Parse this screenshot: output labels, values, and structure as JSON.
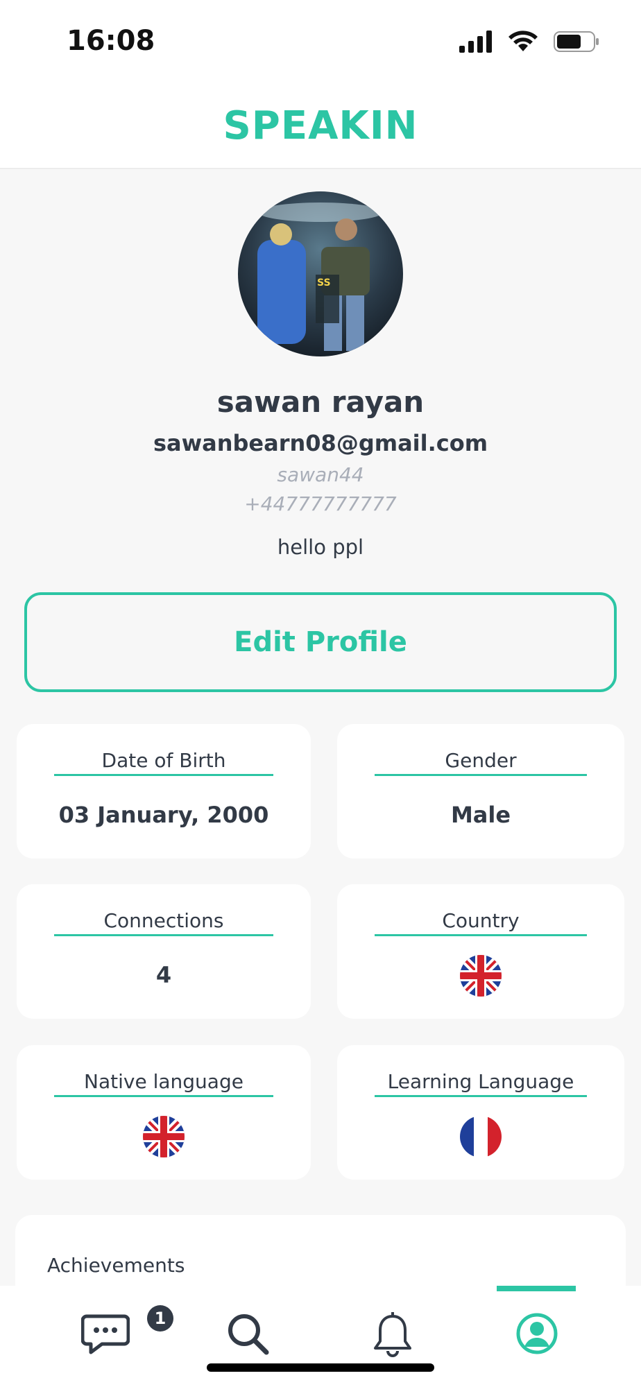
{
  "status_bar": {
    "time": "16:08"
  },
  "header": {
    "title": "SPEAKIN"
  },
  "profile": {
    "name": "sawan rayan",
    "email": "sawanbearn08@gmail.com",
    "username": "sawan44",
    "phone": "+44777777777",
    "bio": "hello ppl"
  },
  "edit_button": {
    "label": "Edit Profile"
  },
  "cards": {
    "dob": {
      "label": "Date of Birth",
      "value": "03 January, 2000"
    },
    "gender": {
      "label": "Gender",
      "value": "Male"
    },
    "connections": {
      "label": "Connections",
      "value": "4"
    },
    "country": {
      "label": "Country",
      "flag": "uk-flag-icon"
    },
    "native_language": {
      "label": "Native language",
      "flag": "uk-flag-icon"
    },
    "learning_language": {
      "label": "Learning Language",
      "flag": "france-flag-icon"
    }
  },
  "achievements": {
    "title": "Achievements"
  },
  "tabbar": {
    "items": [
      {
        "icon": "chat-icon",
        "badge": "1"
      },
      {
        "icon": "search-icon"
      },
      {
        "icon": "bell-icon"
      },
      {
        "icon": "profile-icon",
        "active": true
      }
    ]
  },
  "colors": {
    "accent": "#2cc5a4",
    "text": "#323a46",
    "muted": "#a9aeb8",
    "background": "#f7f7f7"
  }
}
